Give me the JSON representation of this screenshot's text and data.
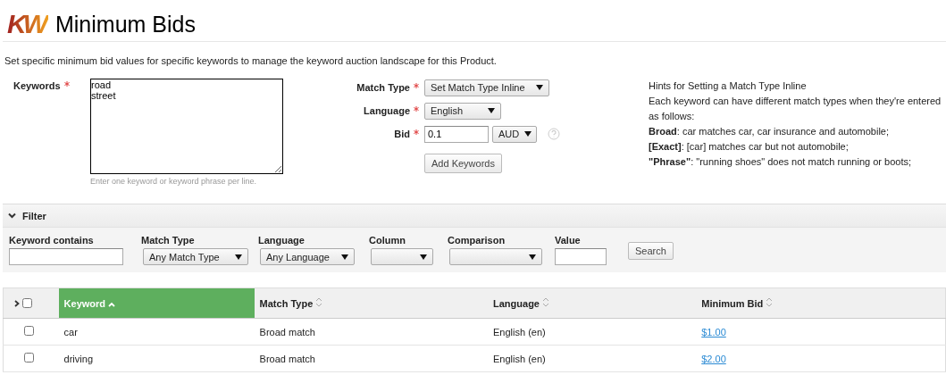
{
  "header": {
    "logo": "KW",
    "title": "Minimum Bids"
  },
  "description": "Set specific minimum bid values for specific keywords to manage the keyword auction landscape for this Product.",
  "form": {
    "keywords": {
      "label": "Keywords",
      "required": true,
      "value": "road\nstreet",
      "hint": "Enter one keyword or keyword phrase per line."
    },
    "match_type": {
      "label": "Match Type",
      "required": true,
      "value": "Set Match Type Inline"
    },
    "language": {
      "label": "Language",
      "required": true,
      "value": "English"
    },
    "bid": {
      "label": "Bid",
      "required": true,
      "value": "0.1",
      "currency": "AUD"
    },
    "add_button": "Add Keywords"
  },
  "hints": {
    "title": "Hints for Setting a Match Type Inline",
    "intro": "Each keyword can have different match types when they're entered as follows:",
    "lines": [
      "**Broad**: car matches car, car insurance and automobile;",
      "**[Exact]**: [car] matches car but not automobile;",
      "**\"Phrase\"**: \"running shoes\" does not match running or boots;"
    ]
  },
  "filter": {
    "title": "Filter",
    "expanded": true,
    "fields": [
      {
        "kind": "text",
        "label": "Keyword contains"
      },
      {
        "kind": "select",
        "label": "Match Type",
        "value": "Any Match Type"
      },
      {
        "kind": "select",
        "label": "Language",
        "value": "Any Language"
      },
      {
        "kind": "select",
        "label": "Column"
      },
      {
        "kind": "select",
        "label": "Comparison"
      },
      {
        "kind": "text",
        "label": "Value"
      }
    ],
    "search_button": "Search"
  },
  "table": {
    "columns": [
      {
        "label": "Keyword",
        "selected": true,
        "sorted": true
      },
      {
        "label": "Match Type",
        "selected": false,
        "sorted": false
      },
      {
        "label": "Language",
        "selected": false,
        "sorted": false
      },
      {
        "label": "Minimum Bid",
        "selected": false,
        "sorted": false
      }
    ],
    "select_all": {
      "checked": false
    },
    "rows": [
      {
        "checked": false,
        "cells": [
          "car",
          "Broad match",
          "English (en)",
          "$1.00"
        ]
      },
      {
        "checked": false,
        "cells": [
          "driving",
          "Broad match",
          "English (en)",
          "$2.00"
        ]
      }
    ]
  }
}
